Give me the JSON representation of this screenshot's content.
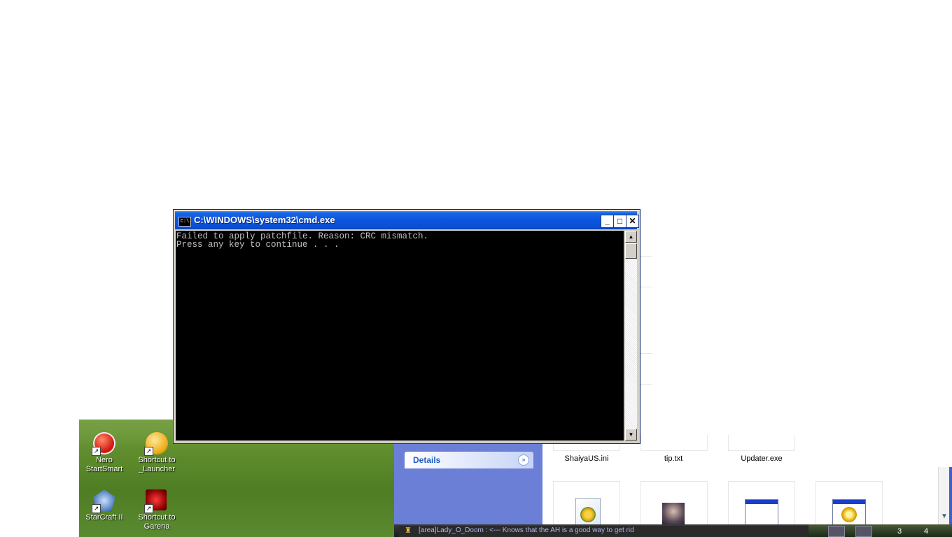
{
  "cmd_window": {
    "title": "C:\\WINDOWS\\system32\\cmd.exe",
    "icon_text": "C:\\",
    "minimize": "_",
    "maximize": "□",
    "close": "✕",
    "lines": [
      "Failed to apply patchfile. Reason: CRC mismatch.",
      "Press any key to continue . . ."
    ],
    "scroll_up": "▲",
    "scroll_down": "▼"
  },
  "desktop": {
    "icons": [
      {
        "label": "Nero\nStartSmart",
        "icon": "nero-icon"
      },
      {
        "label": "Shortcut to\n_Launcher",
        "icon": "launcher-icon"
      },
      {
        "label": "StarCraft II",
        "icon": "starcraft-icon"
      },
      {
        "label": "Shortcut to\nGarena",
        "icon": "garena-icon"
      }
    ]
  },
  "explorer": {
    "details_label": "Details",
    "details_chevron": "»",
    "files": [
      "ShaiyaUS.ini",
      "tip.txt",
      "Updater.exe"
    ],
    "scroll_down": "▼"
  },
  "chat": {
    "message": "[area]Lady_O_Doom : <--- Knows that the AH is a good way to get rid"
  },
  "tray": {
    "slot_3": "3",
    "slot_4": "4"
  }
}
